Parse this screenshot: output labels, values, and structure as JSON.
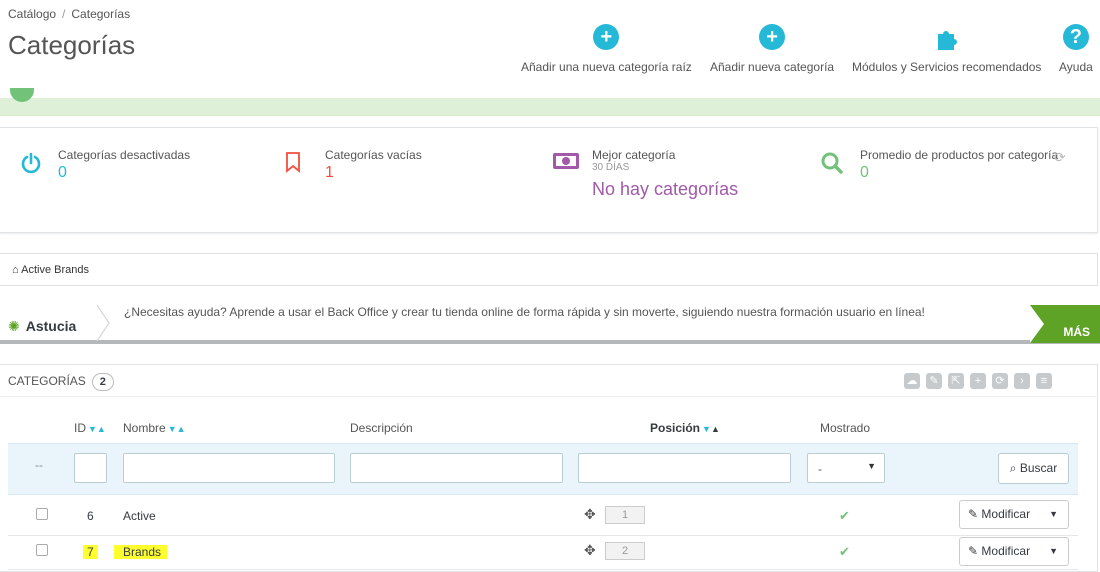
{
  "header": {
    "breadcrumb": [
      "Catálogo",
      "Categorías"
    ],
    "title": "Categorías"
  },
  "toolbar": {
    "add_root_label": "Añadir una nueva categoría raíz",
    "add_label": "Añadir nueva categoría",
    "modules_label": "Módulos y Servicios recomendados",
    "help_label": "Ayuda"
  },
  "kpis": {
    "disabled": {
      "label": "Categorías desactivadas",
      "value": "0",
      "color": "#25b9d7"
    },
    "empty": {
      "label": "Categorías vacías",
      "value": "1",
      "color": "#f54c3e"
    },
    "best": {
      "label": "Mejor categoría",
      "sub": "30 DÍAS",
      "value": "No hay categorías",
      "color": "#a05aa8"
    },
    "average": {
      "label": "Promedio de productos por categoría",
      "value": "0",
      "color": "#72c279"
    }
  },
  "tree": {
    "label": "Active Brands"
  },
  "tip": {
    "label": "Astucia",
    "text": "¿Necesitas ayuda? Aprende a usar el Back Office y crear tu tienda online de forma rápida y sin moverte, siguiendo nuestra formación usuario en línea!",
    "more_label": "MÁS"
  },
  "table": {
    "title": "Categorías",
    "count": "2",
    "columns": {
      "id": "ID",
      "name": "Nombre",
      "description": "Descripción",
      "position": "Posición",
      "shown": "Mostrado"
    },
    "filter": {
      "dash": "--",
      "select_value": "-",
      "search_label": "Buscar"
    },
    "rows": [
      {
        "id": "6",
        "name": "Active",
        "position": "1",
        "shown": true,
        "action": "Modificar"
      },
      {
        "id": "7",
        "name": "Brands",
        "position": "2",
        "shown": true,
        "action": "Modificar"
      }
    ]
  }
}
